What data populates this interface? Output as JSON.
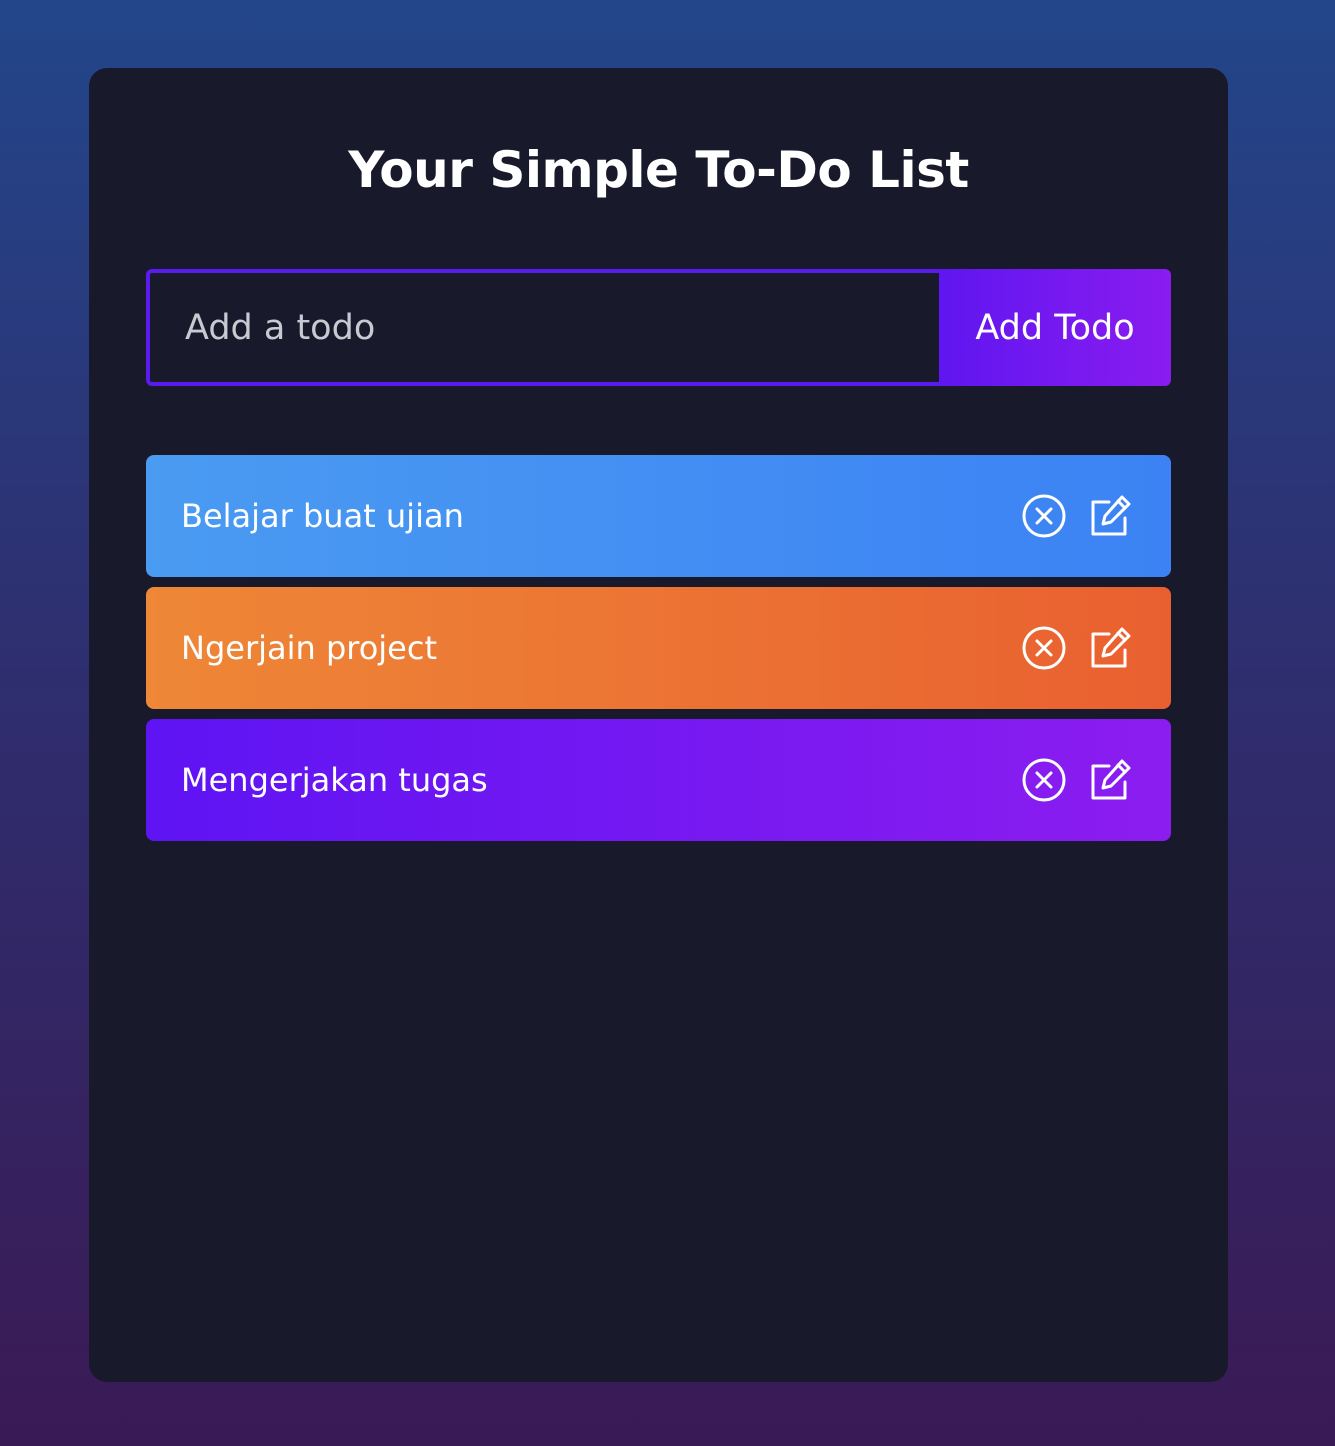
{
  "app": {
    "title": "Your Simple To-Do List"
  },
  "form": {
    "input_value": "",
    "input_placeholder": "Add a todo",
    "button_label": "Add Todo"
  },
  "todos": [
    {
      "text": "Belajar buat ujian",
      "color": "#4a9bf2"
    },
    {
      "text": "Ngerjain project",
      "color": "#ee8737"
    },
    {
      "text": "Mengerjakan tugas",
      "color": "#5e14f3"
    }
  ],
  "icons": {
    "delete": "close-circle-icon",
    "edit": "edit-icon"
  },
  "colors": {
    "accent": "#5b1aee",
    "card_background": "#181a2c"
  }
}
